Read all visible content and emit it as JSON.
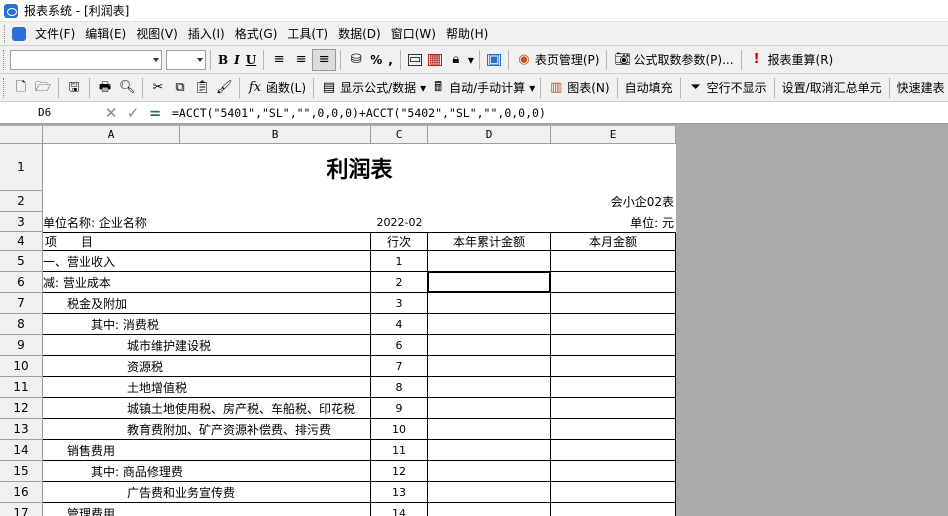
{
  "window": {
    "title": "报表系统 - [利润表]"
  },
  "menu": [
    "文件(F)",
    "编辑(E)",
    "视图(V)",
    "插入(I)",
    "格式(G)",
    "工具(T)",
    "数据(D)",
    "窗口(W)",
    "帮助(H)"
  ],
  "toolbar1": {
    "font_name": "",
    "font_size": "",
    "bold": "B",
    "italic": "I",
    "underline": "U",
    "percent": "%",
    "comma": ",",
    "page_manage": "表页管理(P)",
    "formula_params": "公式取数参数(P)...",
    "recalc": "报表重算(R)"
  },
  "toolbar2": {
    "functions": "函数(L)",
    "show_formula": "显示公式/数据",
    "auto_calc": "自动/手动计算",
    "chart": "图表(N)",
    "auto_fill": "自动填充",
    "hide_blank": "空行不显示",
    "set_summary": "设置/取消汇总单元",
    "quick_build": "快速建表"
  },
  "formula_bar": {
    "cell_ref": "D6",
    "formula": "=ACCT(\"5401\",\"SL\",\"\",0,0,0)+ACCT(\"5402\",\"SL\",\"\",0,0,0)"
  },
  "columns": [
    "A",
    "B",
    "C",
    "D",
    "E"
  ],
  "report": {
    "title": "利润表",
    "form_no": "会小企02表",
    "unit_label": "单位名称: 企业名称",
    "period": "2022-02",
    "currency": "单位: 元",
    "headers": {
      "item": "项　　目",
      "line": "行次",
      "ytd": "本年累计金额",
      "month": "本月金额"
    },
    "rows": [
      {
        "row": "5",
        "item": "一、营业收入",
        "indent": 0,
        "line": "1"
      },
      {
        "row": "6",
        "item": "减: 营业成本",
        "indent": 0,
        "line": "2"
      },
      {
        "row": "7",
        "item": "税金及附加",
        "indent": 1,
        "line": "3"
      },
      {
        "row": "8",
        "item": "其中: 消费税",
        "indent": 2,
        "line": "4"
      },
      {
        "row": "9",
        "item": "城市维护建设税",
        "indent": 3,
        "line": "6"
      },
      {
        "row": "10",
        "item": "资源税",
        "indent": 3,
        "line": "7"
      },
      {
        "row": "11",
        "item": "土地增值税",
        "indent": 3,
        "line": "8"
      },
      {
        "row": "12",
        "item": "城镇土地使用税、房产税、车船税、印花税",
        "indent": 3,
        "line": "9"
      },
      {
        "row": "13",
        "item": "教育费附加、矿产资源补偿费、排污费",
        "indent": 3,
        "line": "10"
      },
      {
        "row": "14",
        "item": "销售费用",
        "indent": 1,
        "line": "11"
      },
      {
        "row": "15",
        "item": "其中: 商品修理费",
        "indent": 2,
        "line": "12"
      },
      {
        "row": "16",
        "item": "广告费和业务宣传费",
        "indent": 3,
        "line": "13"
      },
      {
        "row": "17",
        "item": "管理费用",
        "indent": 1,
        "line": "14"
      }
    ],
    "top_rows": [
      "1",
      "2",
      "3",
      "4"
    ]
  }
}
